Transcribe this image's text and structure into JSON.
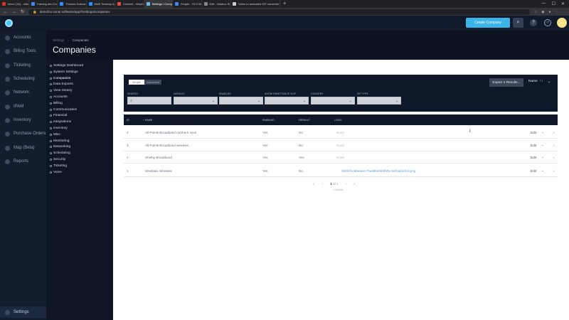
{
  "browser": {
    "tabs": [
      {
        "label": "Inbox (16) - mitchell@sonar.soft",
        "color": "#d93025"
      },
      {
        "label": "Training and Documentation To",
        "color": "#4285f4"
      },
      {
        "label": "Thomas Sullivan Crawford's Zo",
        "color": "#2d8cff"
      },
      {
        "label": "Multi Tenancy & How it Works in",
        "color": "#2d8cff"
      },
      {
        "label": "Content - HelpDocs",
        "color": "#e94b3c"
      },
      {
        "label": "Settings / Companies",
        "color": "#6fb8e8"
      },
      {
        "label": "People · SCII Webclient",
        "color": "#4285f4"
      },
      {
        "label": "Edit - Nimbus Screenshot",
        "color": "#888888"
      },
      {
        "label": "Video to animated GIF converter",
        "color": "#cccccc"
      }
    ],
    "new_tab": "+",
    "url": "demofoo.sonar.software/app#/settings/companies",
    "win_min": "—",
    "win_max": "☐",
    "win_close": "✕"
  },
  "header": {
    "create_label": "Create Company",
    "search_icon": "⌕",
    "help_icon": "?",
    "history_icon": "↺"
  },
  "nav": [
    {
      "label": "Accounts",
      "icon": "accounts-icon"
    },
    {
      "label": "Billing Tools",
      "icon": "billing-icon"
    },
    {
      "label": "Ticketing",
      "icon": "ticket-icon"
    },
    {
      "label": "Scheduling",
      "icon": "calendar-icon"
    },
    {
      "label": "Network",
      "icon": "network-icon"
    },
    {
      "label": "IPAM",
      "icon": "ipam-icon"
    },
    {
      "label": "Inventory",
      "icon": "inventory-icon"
    },
    {
      "label": "Purchase Orders",
      "icon": "purchase-icon"
    },
    {
      "label": "Map (Beta)",
      "icon": "map-icon"
    },
    {
      "label": "Reports",
      "icon": "reports-icon"
    }
  ],
  "nav_settings": "Settings",
  "breadcrumb": {
    "parent": "Settings",
    "sep": "›",
    "current": "Companies"
  },
  "page_title": "Companies",
  "settings_menu": [
    "Settings Dashboard",
    "System Settings",
    "Companies",
    "Data Exports",
    "View History",
    "Accounts",
    "Billing",
    "Communication",
    "Financial",
    "Integrations",
    "Inventory",
    "Misc",
    "Monitoring",
    "Networking",
    "Scheduling",
    "Security",
    "Ticketing",
    "Voice"
  ],
  "filters": {
    "simple": "Simple",
    "advanced": "Advanced",
    "export_label": "Export 4 Results...",
    "sort_label": "Name",
    "sort_dir": "↑↓",
    "sort_chevron": "⌄",
    "labels": [
      "SEARCH",
      "DEFAULT",
      "ENABLED",
      "SHOW REMITTANCE SLIP",
      "COUNTRY",
      "ZIP TYPE"
    ],
    "search_icon": "⌕",
    "select_chevron": "⌄"
  },
  "table": {
    "headers": [
      "ID",
      "↑ NAME",
      "ENABLED",
      "DEFAULT",
      "LOGO"
    ],
    "rows": [
      {
        "id": "4",
        "name": "All Points Broadband northern neck",
        "enabled": "Yes",
        "default": "No",
        "logo": "None"
      },
      {
        "id": "3",
        "name": "All Points Broadband wireless",
        "enabled": "Yes",
        "default": "No",
        "logo": "None"
      },
      {
        "id": "2",
        "name": "Shelby Broadband",
        "enabled": "Yes",
        "default": "Yes",
        "logo": "None"
      },
      {
        "id": "1",
        "name": "Westlake Wireless",
        "enabled": "Yes",
        "default": "No",
        "logo": "353f4f1c90eae8-73ed8b0083f90e-8df1ab2cfc5.png"
      }
    ],
    "edit_label": "Edit",
    "edit_chevron": "⌄",
    "row_chevron": "›"
  },
  "pager": {
    "first": "«",
    "prev": "‹",
    "current": "1",
    "of": "of 1",
    "next": "›",
    "last": "»",
    "info": "4 Results"
  }
}
